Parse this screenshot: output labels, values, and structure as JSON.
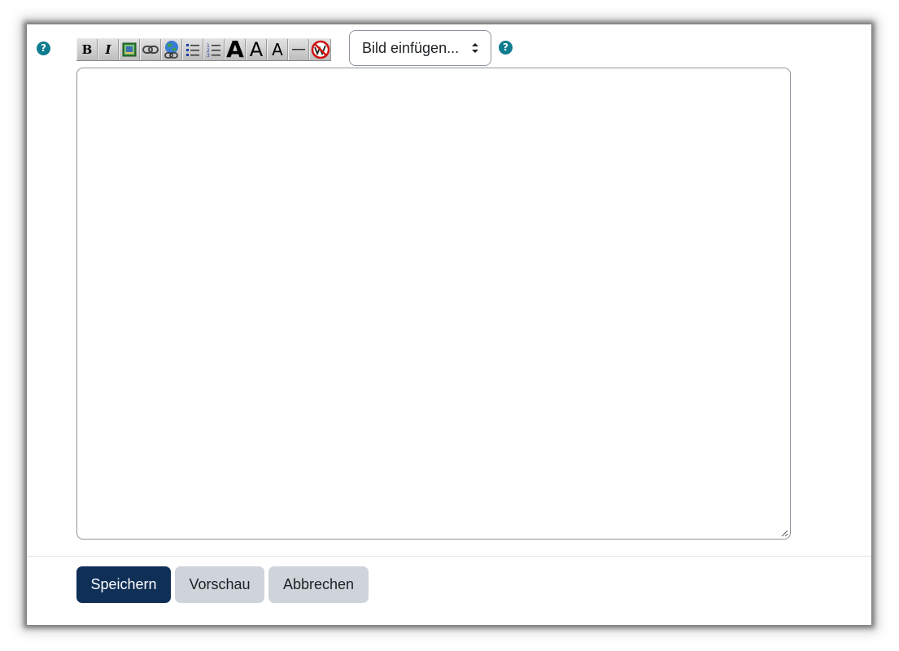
{
  "editor": {
    "help_left_glyph": "?",
    "help_right_glyph": "?",
    "toolbar": {
      "bold": "B",
      "italic": "I",
      "heading_large": "A",
      "heading_medium": "A",
      "heading_small": "A",
      "icons": [
        "bold-icon",
        "italic-icon",
        "insert-image-icon",
        "insert-link-icon",
        "web-link-icon",
        "bullet-list-icon",
        "numbered-list-icon",
        "heading-large-icon",
        "heading-medium-icon",
        "heading-small-icon",
        "horizontal-rule-icon",
        "nowiki-icon"
      ]
    },
    "insert_image_select": {
      "selected": "Bild einfügen..."
    },
    "textarea_value": ""
  },
  "actions": {
    "save_label": "Speichern",
    "preview_label": "Vorschau",
    "cancel_label": "Abbrechen"
  },
  "colors": {
    "help_icon": "#0f7c8f",
    "primary_button": "#0f2f57",
    "secondary_button": "#ced4da"
  }
}
